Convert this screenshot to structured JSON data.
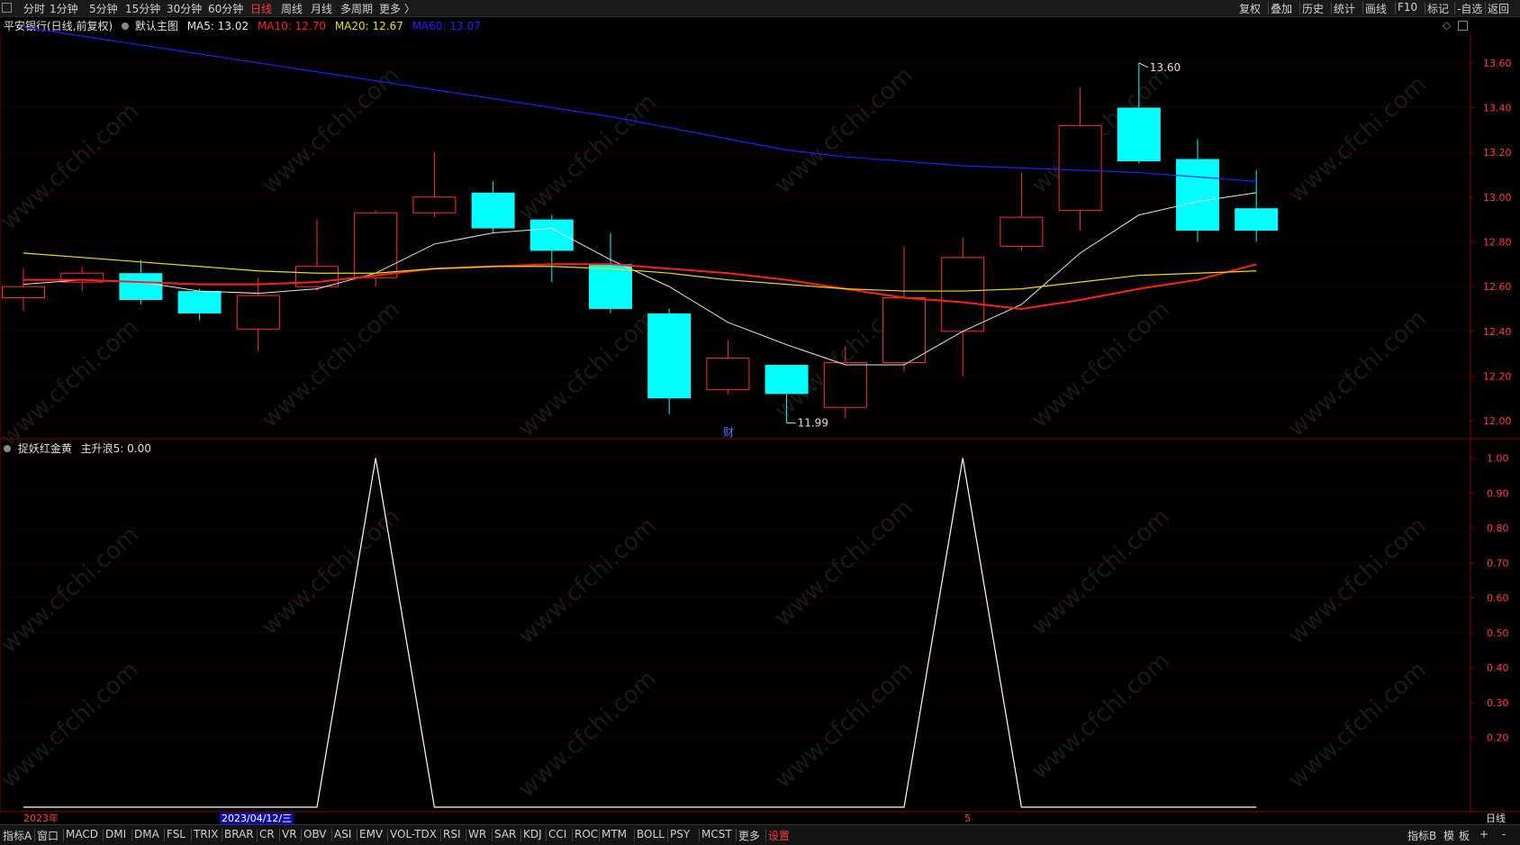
{
  "toolbar": {
    "left_items": [
      "分时",
      "1分钟",
      "5分钟",
      "15分钟",
      "30分钟",
      "60分钟",
      "日线",
      "周线",
      "月线",
      "多周期",
      "更多 〉"
    ],
    "active_index": 6,
    "right_items": [
      "复权",
      "叠加",
      "历史",
      "统计",
      "画线",
      "F10",
      "标记",
      "-自选",
      "返回"
    ]
  },
  "main_info": {
    "title": "平安银行(日线,前复权)",
    "template": "默认主图",
    "ma5": "MA5: 13.02",
    "ma10": "MA10: 12.70",
    "ma20": "MA20: 12.67",
    "ma60": "MA60: 13.07",
    "icons": [
      "diamond-icon",
      "maximize-icon"
    ]
  },
  "sub_info": {
    "indicator": "捉妖红金黄",
    "value": "主升浪5: 0.00"
  },
  "annotations": {
    "high_label": "13.60",
    "low_label": "11.99",
    "cai_marker": "财"
  },
  "date_axis": {
    "year_label": "2023年",
    "cursor_date": "2023/04/12/三",
    "month_label": "5",
    "period_label": "日线"
  },
  "bottom_bar": {
    "items": [
      "指标A",
      "窗口",
      "MACD",
      "DMI",
      "DMA",
      "FSL",
      "TRIX",
      "BRAR",
      "CR",
      "VR",
      "OBV",
      "ASI",
      "EMV",
      "VOL-TDX",
      "RSI",
      "WR",
      "SAR",
      "KDJ",
      "CCI",
      "ROC",
      "MTM",
      "BOLL",
      "PSY",
      "MCST",
      "更多",
      "设置"
    ],
    "active_index": 25,
    "right_items": [
      "指标B",
      "模",
      "板",
      "+",
      "-"
    ]
  },
  "watermark": "www.cfchi.com",
  "colors": {
    "up": "#ff3030",
    "down": "#00ffff",
    "ma5": "#e8e8e8",
    "ma10": "#ff2020",
    "ma20": "#e8e000",
    "ma60": "#2020ff",
    "axis": "#8b0000",
    "text_axis": "#ff4040"
  },
  "chart_data": [
    {
      "type": "candlestick",
      "title": "平安银行(日线,前复权)",
      "ylim": [
        11.94,
        13.72
      ],
      "y_ticks": [
        12.0,
        12.2,
        12.4,
        12.6,
        12.8,
        13.0,
        13.2,
        13.4,
        13.6
      ],
      "candles": [
        {
          "o": 12.55,
          "c": 12.6,
          "h": 12.68,
          "l": 12.49
        },
        {
          "o": 12.62,
          "c": 12.66,
          "h": 12.69,
          "l": 12.58
        },
        {
          "o": 12.66,
          "c": 12.54,
          "h": 12.72,
          "l": 12.52
        },
        {
          "o": 12.58,
          "c": 12.48,
          "h": 12.59,
          "l": 12.45
        },
        {
          "o": 12.41,
          "c": 12.56,
          "h": 12.64,
          "l": 12.31
        },
        {
          "o": 12.6,
          "c": 12.69,
          "h": 12.9,
          "l": 12.58
        },
        {
          "o": 12.64,
          "c": 12.93,
          "h": 12.94,
          "l": 12.6
        },
        {
          "o": 12.93,
          "c": 13.0,
          "h": 13.2,
          "l": 12.91
        },
        {
          "o": 13.02,
          "c": 12.86,
          "h": 13.07,
          "l": 12.84
        },
        {
          "o": 12.9,
          "c": 12.76,
          "h": 12.92,
          "l": 12.62
        },
        {
          "o": 12.7,
          "c": 12.5,
          "h": 12.84,
          "l": 12.48
        },
        {
          "o": 12.48,
          "c": 12.1,
          "h": 12.5,
          "l": 12.03
        },
        {
          "o": 12.14,
          "c": 12.28,
          "h": 12.36,
          "l": 12.12
        },
        {
          "o": 12.25,
          "c": 12.12,
          "h": 12.25,
          "l": 11.99
        },
        {
          "o": 12.06,
          "c": 12.26,
          "h": 12.33,
          "l": 12.01
        },
        {
          "o": 12.26,
          "c": 12.55,
          "h": 12.78,
          "l": 12.22
        },
        {
          "o": 12.4,
          "c": 12.73,
          "h": 12.82,
          "l": 12.2
        },
        {
          "o": 12.78,
          "c": 12.91,
          "h": 13.11,
          "l": 12.76
        },
        {
          "o": 12.94,
          "c": 13.32,
          "h": 13.49,
          "l": 12.85
        },
        {
          "o": 13.4,
          "c": 13.16,
          "h": 13.6,
          "l": 13.15
        },
        {
          "o": 13.17,
          "c": 12.85,
          "h": 13.26,
          "l": 12.8
        },
        {
          "o": 12.95,
          "c": 12.85,
          "h": 13.12,
          "l": 12.8
        }
      ],
      "series": [
        {
          "name": "MA5",
          "values": [
            12.61,
            12.63,
            12.62,
            12.58,
            12.57,
            12.59,
            12.66,
            12.79,
            12.84,
            12.86,
            12.72,
            12.6,
            12.44,
            12.34,
            12.25,
            12.25,
            12.4,
            12.52,
            12.75,
            12.92,
            12.98,
            13.02
          ]
        },
        {
          "name": "MA10",
          "values": [
            12.63,
            12.63,
            12.62,
            12.61,
            12.61,
            12.62,
            12.65,
            12.68,
            12.69,
            12.7,
            12.7,
            12.68,
            12.66,
            12.63,
            12.59,
            12.55,
            12.53,
            12.5,
            12.54,
            12.59,
            12.63,
            12.7
          ]
        },
        {
          "name": "MA20",
          "values": [
            12.75,
            12.73,
            12.71,
            12.69,
            12.67,
            12.66,
            12.66,
            12.68,
            12.69,
            12.69,
            12.68,
            12.66,
            12.63,
            12.61,
            12.59,
            12.58,
            12.58,
            12.59,
            12.62,
            12.65,
            12.66,
            12.67
          ]
        },
        {
          "name": "MA60",
          "values": [
            13.76,
            13.72,
            13.68,
            13.64,
            13.6,
            13.56,
            13.52,
            13.48,
            13.44,
            13.4,
            13.36,
            13.31,
            13.26,
            13.21,
            13.18,
            13.16,
            13.14,
            13.13,
            13.12,
            13.11,
            13.09,
            13.07
          ]
        }
      ]
    },
    {
      "type": "line",
      "title": "捉妖红金黄",
      "ylim": [
        0.0,
        1.04
      ],
      "y_ticks": [
        0.2,
        0.3,
        0.4,
        0.5,
        0.6,
        0.7,
        0.8,
        0.9,
        1.0
      ],
      "series": [
        {
          "name": "主升浪5",
          "values": [
            0,
            0,
            0,
            0,
            0,
            0,
            1,
            0,
            0,
            0,
            0,
            0,
            0,
            0,
            0,
            0,
            1,
            0,
            0,
            0,
            0,
            0
          ]
        }
      ]
    }
  ]
}
